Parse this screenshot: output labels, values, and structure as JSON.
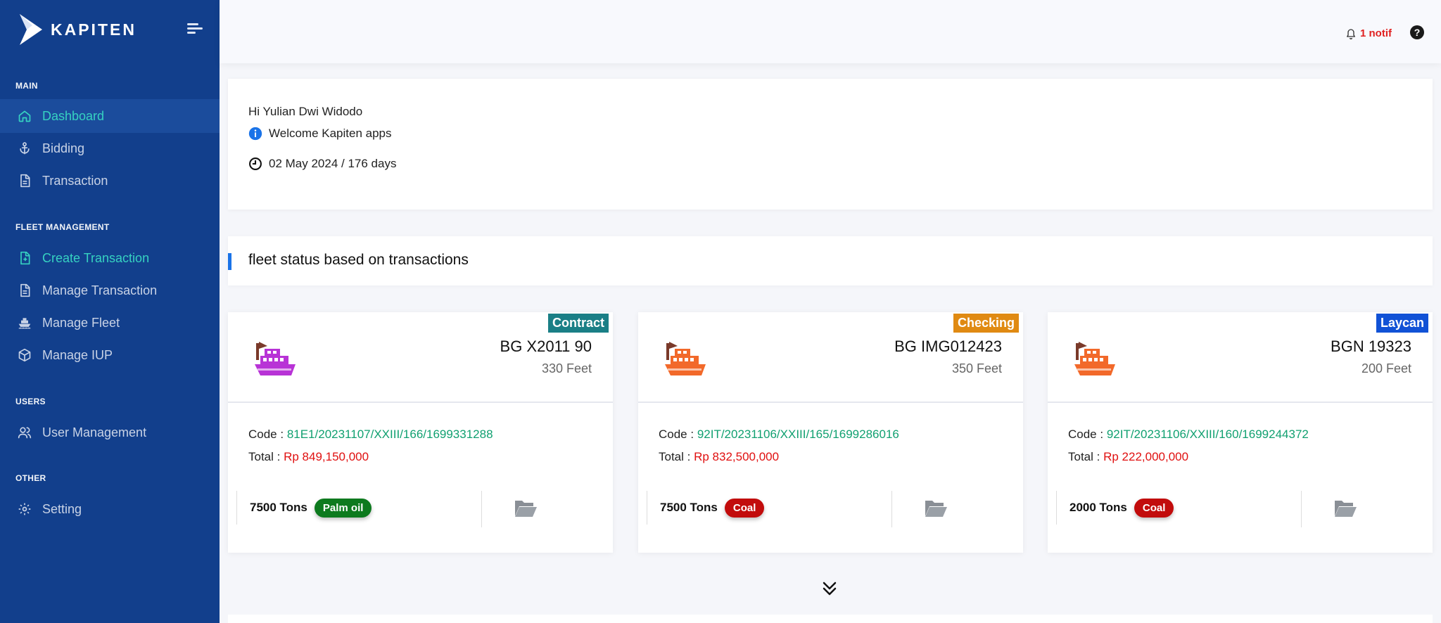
{
  "brand": {
    "name": "KAPITEN"
  },
  "sidebar": {
    "sections": {
      "main": "MAIN",
      "fleet": "FLEET MANAGEMENT",
      "users": "USERS",
      "other": "OTHER"
    },
    "items": {
      "dashboard": "Dashboard",
      "bidding": "Bidding",
      "transaction": "Transaction",
      "create_transaction": "Create Transaction",
      "manage_transaction": "Manage Transaction",
      "manage_fleet": "Manage Fleet",
      "manage_iup": "Manage IUP",
      "user_management": "User Management",
      "setting": "Setting"
    }
  },
  "topbar": {
    "notif": "1 notif",
    "help": "?"
  },
  "welcome": {
    "greeting": "Hi Yulian Dwi Widodo",
    "message": "Welcome Kapiten apps",
    "date": "02 May 2024 / 176 days"
  },
  "fleet_section": {
    "title": "fleet status based on transactions"
  },
  "labels": {
    "code": "Code : ",
    "total": "Total : "
  },
  "cards": [
    {
      "status": "Contract",
      "status_color": "#1a7f86",
      "ship_color": "#b833d6",
      "name": "BG X2011 90",
      "size": "330 Feet",
      "code": "81E1/20231107/XXIII/166/1699331288",
      "total": "Rp 849,150,000",
      "tons": "7500 Tons",
      "cargo": "Palm oil",
      "cargo_color": "#0d7a1e"
    },
    {
      "status": "Checking",
      "status_color": "#e08a12",
      "ship_color": "#f2692a",
      "name": "BG IMG012423",
      "size": "350 Feet",
      "code": "92IT/20231106/XXIII/165/1699286016",
      "total": "Rp 832,500,000",
      "tons": "7500 Tons",
      "cargo": "Coal",
      "cargo_color": "#c20c0c"
    },
    {
      "status": "Laycan",
      "status_color": "#1152d6",
      "ship_color": "#f2692a",
      "name": "BGN 19323",
      "size": "200 Feet",
      "code": "92IT/20231106/XXIII/160/1699244372",
      "total": "Rp 222,000,000",
      "tons": "2000 Tons",
      "cargo": "Coal",
      "cargo_color": "#c20c0c"
    }
  ]
}
